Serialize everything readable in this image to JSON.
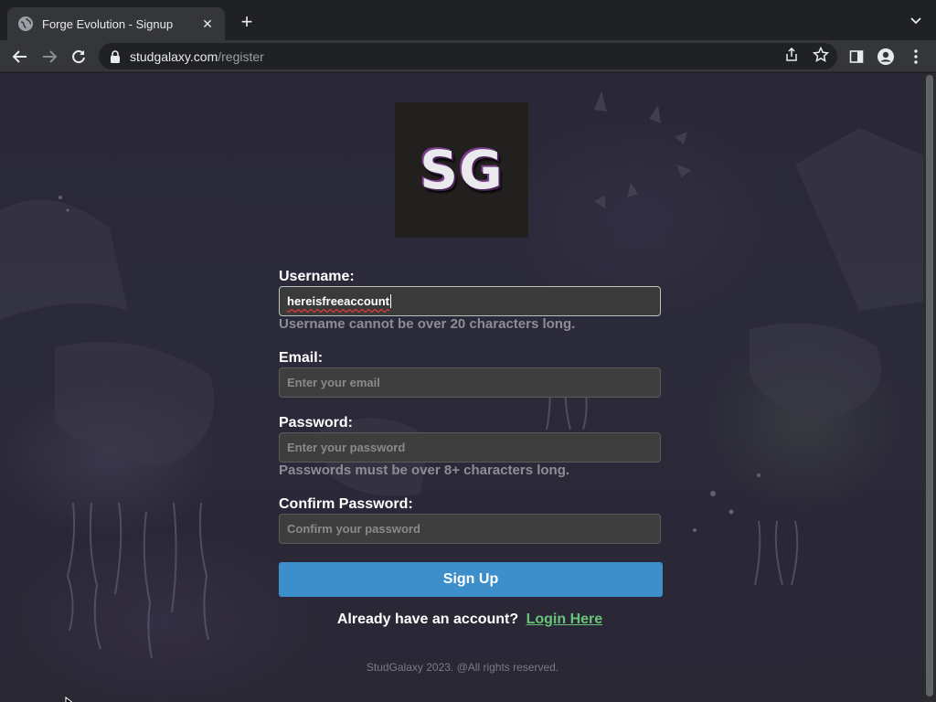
{
  "browser": {
    "tab_title": "Forge Evolution - Signup",
    "url_host": "studgalaxy.com",
    "url_path": "/register"
  },
  "logo": {
    "text": "SG"
  },
  "form": {
    "username_label": "Username:",
    "username_value": "hereisfreeaccount",
    "username_hint": "Username cannot be over 20 characters long.",
    "email_label": "Email:",
    "email_placeholder": "Enter your email",
    "password_label": "Password:",
    "password_placeholder": "Enter your password",
    "password_hint": "Passwords must be over 8+ characters long.",
    "confirm_label": "Confirm Password:",
    "confirm_placeholder": "Confirm your password",
    "submit_label": "Sign Up"
  },
  "login": {
    "prompt": "Already have an account?",
    "link_text": "Login Here"
  },
  "footer": {
    "text": "StudGalaxy 2023. @All rights reserved."
  },
  "colors": {
    "accent_button": "#3c8fca",
    "link": "#6ac37a",
    "background": "#2a2838"
  }
}
